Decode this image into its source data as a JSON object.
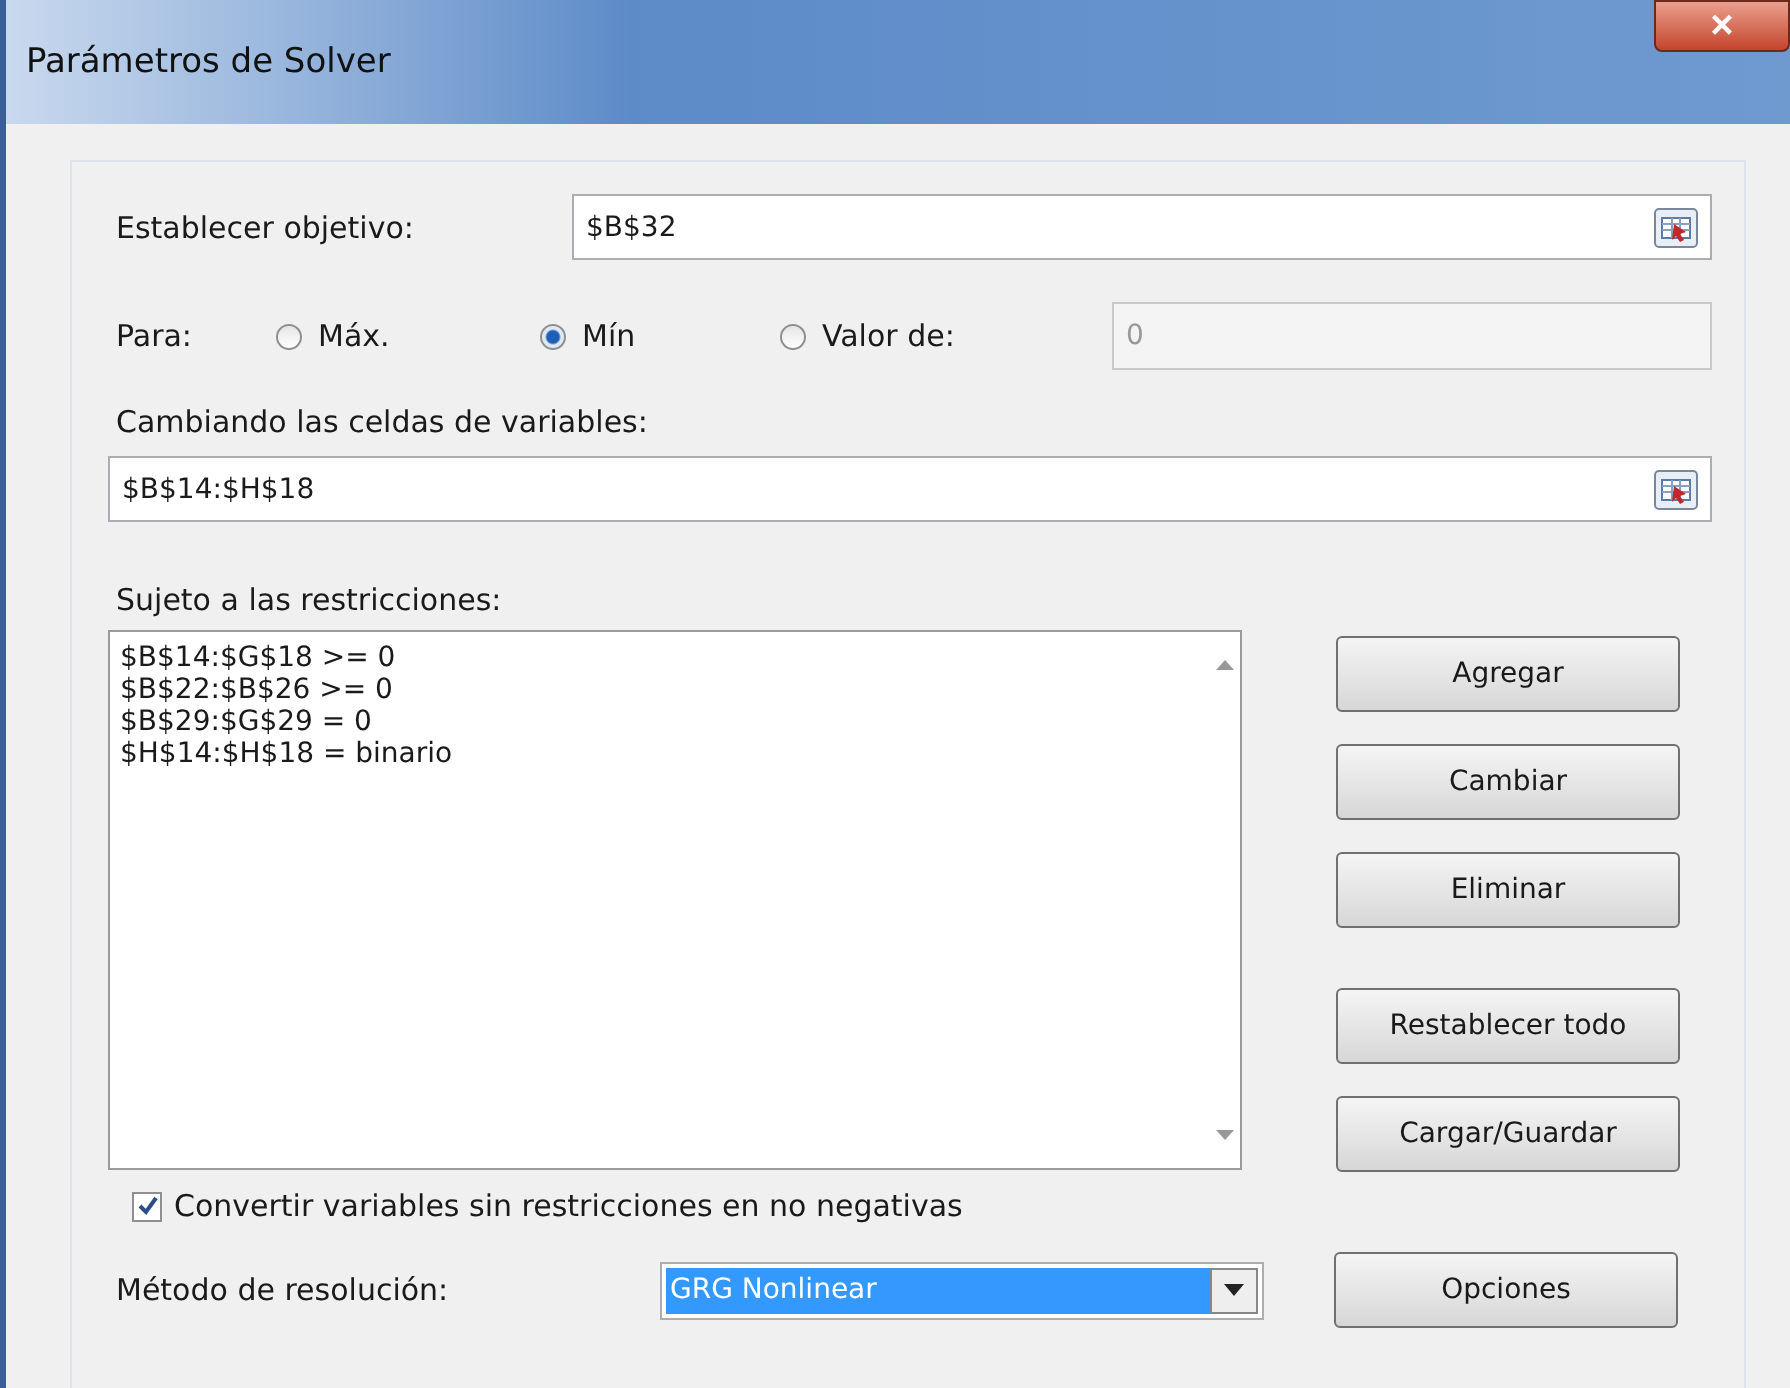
{
  "window": {
    "title": "Parámetros de Solver",
    "close": "×"
  },
  "objective": {
    "label": "Establecer objetivo:",
    "value": "$B$32"
  },
  "para": {
    "label": "Para:",
    "options": [
      {
        "label": "Máx.",
        "selected": false
      },
      {
        "label": "Mín",
        "selected": true
      },
      {
        "label": "Valor de:",
        "selected": false
      }
    ],
    "value_field": {
      "value": "0",
      "disabled": true
    }
  },
  "variables": {
    "label": "Cambiando las celdas de variables:",
    "value": "$B$14:$H$18"
  },
  "constraints": {
    "label": "Sujeto a las restricciones:",
    "items": [
      "$B$14:$G$18 >= 0",
      "$B$22:$B$26 >= 0",
      "$B$29:$G$29 = 0",
      "$H$14:$H$18 = binario"
    ]
  },
  "buttons": [
    {
      "label": "Agregar"
    },
    {
      "label": "Cambiar"
    },
    {
      "label": "Eliminar"
    },
    {
      "label": "Restablecer todo"
    },
    {
      "label": "Cargar/Guardar"
    }
  ],
  "nonnegative": {
    "label": "Convertir variables sin restricciones en no negativas",
    "checked": true
  },
  "method": {
    "label": "Método de resolución:",
    "value": "GRG Nonlinear"
  },
  "options_button": {
    "label": "Opciones"
  }
}
